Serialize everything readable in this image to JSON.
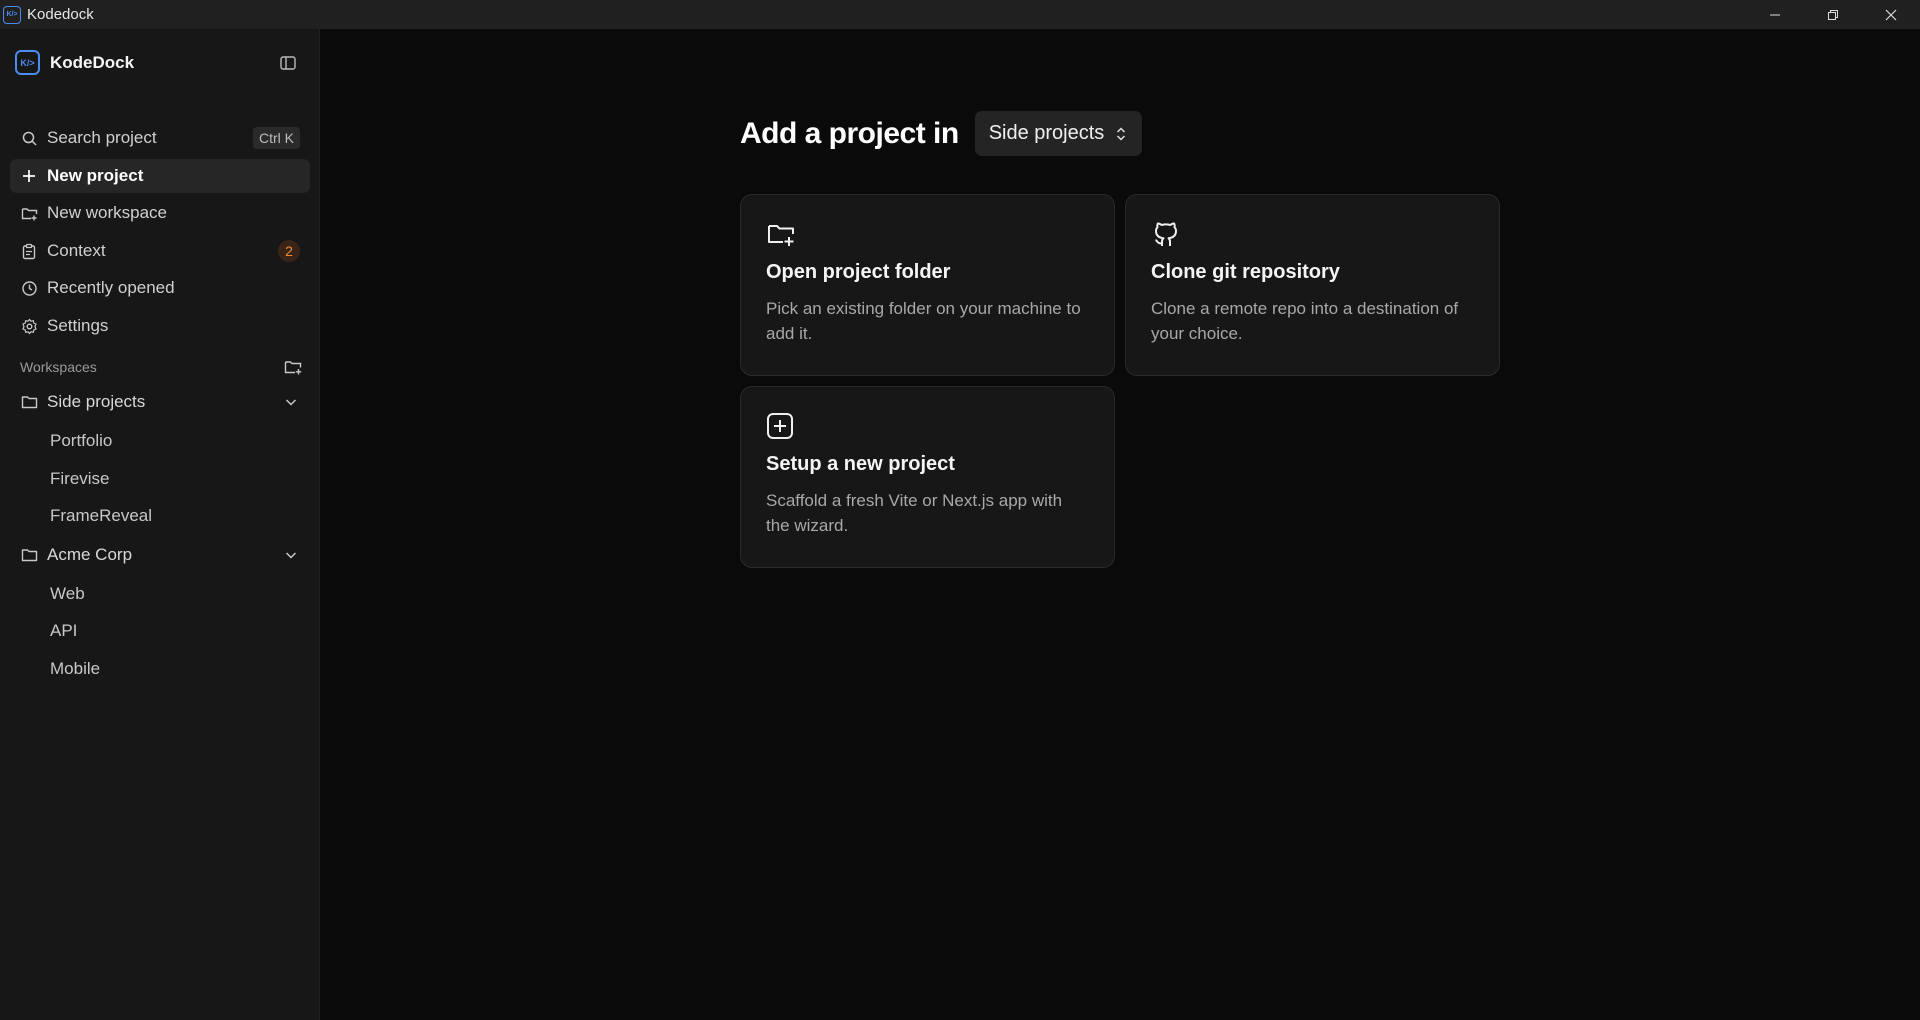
{
  "window": {
    "title": "Kodedock",
    "app_icon_glyph": "K/>"
  },
  "sidebar": {
    "brand": {
      "name": "KodeDock",
      "logo_glyph": "K/>"
    },
    "nav": [
      {
        "label": "Search project",
        "icon": "search-icon",
        "shortcut": "Ctrl K"
      },
      {
        "label": "New project",
        "icon": "plus-icon",
        "active": true
      },
      {
        "label": "New workspace",
        "icon": "folder-plus-icon"
      },
      {
        "label": "Context",
        "icon": "clipboard-icon",
        "badge": "2"
      },
      {
        "label": "Recently opened",
        "icon": "clock-icon"
      },
      {
        "label": "Settings",
        "icon": "gear-icon"
      }
    ],
    "workspaces_label": "Workspaces",
    "workspaces": [
      {
        "name": "Side projects",
        "projects": [
          "Portfolio",
          "Firevise",
          "FrameReveal"
        ]
      },
      {
        "name": "Acme Corp",
        "projects": [
          "Web",
          "API",
          "Mobile"
        ]
      }
    ]
  },
  "main": {
    "heading": "Add a project in",
    "workspace_select": {
      "value": "Side projects"
    },
    "cards": [
      {
        "title": "Open project folder",
        "description": "Pick an existing folder on your machine to add it.",
        "icon": "folder-plus-icon"
      },
      {
        "title": "Clone git repository",
        "description": "Clone a remote repo into a destination of your choice.",
        "icon": "github-icon"
      },
      {
        "title": "Setup a new project",
        "description": "Scaffold a fresh Vite or Next.js app with the wizard.",
        "icon": "plus-square-icon"
      }
    ]
  },
  "colors": {
    "accent": "#4a8cf0",
    "badge": "#f08a3c",
    "sidebar_bg": "#171717",
    "main_bg": "#0a0a0a"
  }
}
